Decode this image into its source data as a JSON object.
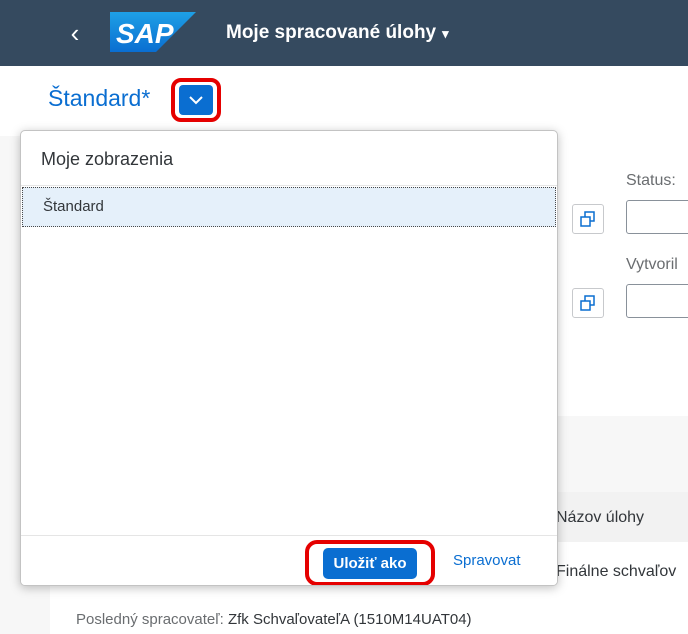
{
  "shell": {
    "back_icon": "chevron-left-icon",
    "logo_text": "SAP",
    "app_title": "Moje spracované úlohy",
    "title_caret": "▾"
  },
  "header": {
    "variant_title": "Štandard*"
  },
  "filters": {
    "status_label": "Status:",
    "created_by_label": "Vytvoril"
  },
  "popover": {
    "title": "Moje zobrazenia",
    "items": [
      {
        "label": "Štandard",
        "selected": true
      }
    ],
    "save_as_label": "Uložiť ako",
    "manage_label": "Spravovat"
  },
  "table": {
    "columns": [
      "Názov úlohy"
    ],
    "rows": [
      {
        "task_name": "Finálne schvaľov",
        "last_processor_label": "Posledný spracovateľ:",
        "last_processor_value": "Zfk SchvaľovateľA (1510M14UAT04)"
      }
    ]
  },
  "colors": {
    "shell_bg": "#354a5f",
    "accent": "#0a6ed1",
    "highlight": "#e50000"
  }
}
